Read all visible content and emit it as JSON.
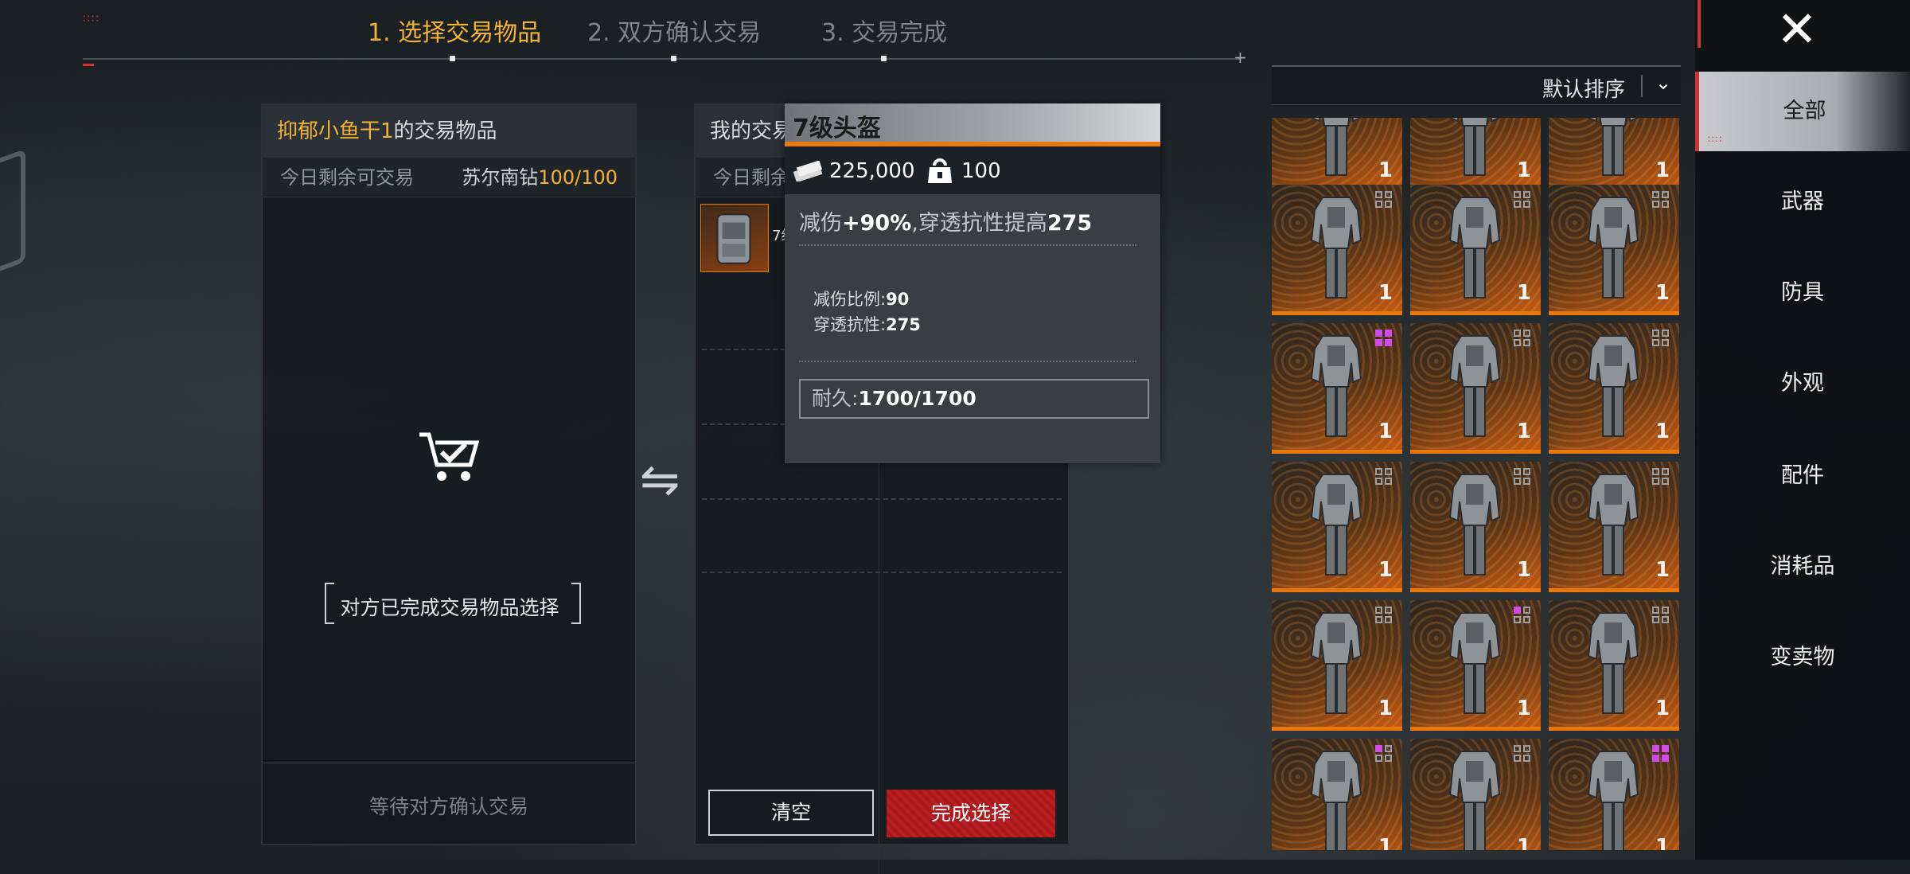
{
  "steps": [
    {
      "label": "1. 选择交易物品"
    },
    {
      "label": "2. 双方确认交易"
    },
    {
      "label": "3. 交易完成"
    }
  ],
  "left_panel": {
    "title_name": "抑郁小鱼干1",
    "title_suffix": "的交易物品",
    "remaining_label": "今日剩余可交易",
    "currency_label": "苏尔南钻",
    "currency_value": "100/100",
    "empty_message": "对方已完成交易物品选择",
    "footer": "等待对方确认交易"
  },
  "middle_panel": {
    "title": "我的交易",
    "remaining_label": "今日剩余",
    "slot_name": "7级",
    "buttons": {
      "clear": "清空",
      "done": "完成选择"
    }
  },
  "tooltip": {
    "title": "7级头盔",
    "price": "225,000",
    "weight": "100",
    "effect_prefix": "减伤",
    "effect_value": "+90%",
    "effect_mid": ",穿透抗性提高",
    "effect_value2": "275",
    "reduction_label": "减伤比例:",
    "reduction_value": "90",
    "resist_label": "穿透抗性:",
    "resist_value": "275",
    "durability_label": "耐久:",
    "durability_value": "1700/1700"
  },
  "sort": {
    "label": "默认排序"
  },
  "inventory": {
    "rows": [
      [
        "none",
        "none",
        "none"
      ],
      [
        "grey",
        "grey",
        "grey"
      ],
      [
        "purple",
        "grey",
        "grey"
      ],
      [
        "grey",
        "grey",
        "grey"
      ],
      [
        "grey",
        "mix",
        "grey"
      ],
      [
        "mix",
        "grey",
        "purple"
      ]
    ],
    "count": "1",
    "colors": {
      "rarity_orange": "#e8780e",
      "tag_purple": "#d04be6"
    }
  },
  "nav": {
    "items": [
      "全部",
      "武器",
      "防具",
      "外观",
      "配件",
      "消耗品",
      "变卖物"
    ],
    "selected": "全部"
  },
  "colors": {
    "accent": "#f2b233",
    "danger": "#b91f22",
    "orange": "#e87a12"
  }
}
